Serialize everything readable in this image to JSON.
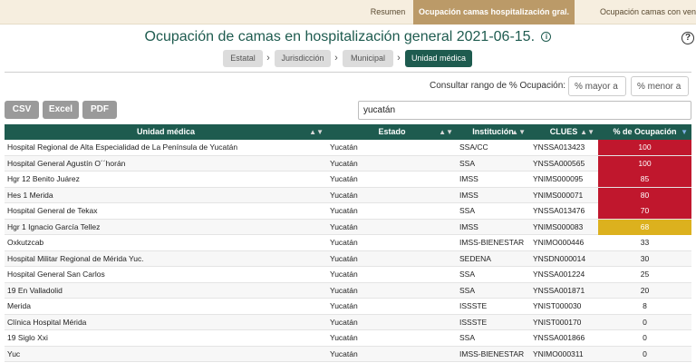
{
  "tabs": [
    {
      "label": "Resumen"
    },
    {
      "label": "Ocupación camas hospitalización gral."
    },
    {
      "label": "Ocupación camas con venti"
    }
  ],
  "title": "Ocupación de camas en hospitalización general 2021-06-15.",
  "info_glyph": "i",
  "help_glyph": "?",
  "breadcrumb": [
    {
      "label": "Estatal"
    },
    {
      "label": "Jurisdicción"
    },
    {
      "label": "Municipal"
    },
    {
      "label": "Unidad médica"
    }
  ],
  "range": {
    "label": "Consultar rango de % Ocupación:",
    "mayor_placeholder": "% mayor a",
    "menor_placeholder": "% menor a"
  },
  "export": {
    "csv": "CSV",
    "excel": "Excel",
    "pdf": "PDF"
  },
  "search": {
    "value": "yucatán"
  },
  "colors": {
    "primary": "#1e5b4f",
    "tab_active": "#bb9a68",
    "high": "#c0172d",
    "medium": "#dcb11e"
  },
  "table": {
    "columns": [
      {
        "label": "Unidad médica"
      },
      {
        "label": "Estado"
      },
      {
        "label": "Institución"
      },
      {
        "label": "CLUES"
      },
      {
        "label": "% de Ocupación"
      }
    ],
    "rows": [
      {
        "unidad": "Hospital Regional de Alta Especialidad de La Península de Yucatán",
        "estado": "Yucatán",
        "institucion": "SSA/CC",
        "clues": "YNSSA013423",
        "ocupacion": "100",
        "level": "high"
      },
      {
        "unidad": "Hospital General Agustín O´´horán",
        "estado": "Yucatán",
        "institucion": "SSA",
        "clues": "YNSSA000565",
        "ocupacion": "100",
        "level": "high"
      },
      {
        "unidad": "Hgr 12 Benito Juárez",
        "estado": "Yucatán",
        "institucion": "IMSS",
        "clues": "YNIMS000095",
        "ocupacion": "85",
        "level": "high"
      },
      {
        "unidad": "Hes 1 Merida",
        "estado": "Yucatán",
        "institucion": "IMSS",
        "clues": "YNIMS000071",
        "ocupacion": "80",
        "level": "high"
      },
      {
        "unidad": "Hospital General de Tekax",
        "estado": "Yucatán",
        "institucion": "SSA",
        "clues": "YNSSA013476",
        "ocupacion": "70",
        "level": "high"
      },
      {
        "unidad": "Hgr 1 Ignacio García Tellez",
        "estado": "Yucatán",
        "institucion": "IMSS",
        "clues": "YNIMS000083",
        "ocupacion": "68",
        "level": "medium"
      },
      {
        "unidad": "Oxkutzcab",
        "estado": "Yucatán",
        "institucion": "IMSS-BIENESTAR",
        "clues": "YNIMO000446",
        "ocupacion": "33",
        "level": "low"
      },
      {
        "unidad": "Hospital Militar Regional de Mérida Yuc.",
        "estado": "Yucatán",
        "institucion": "SEDENA",
        "clues": "YNSDN000014",
        "ocupacion": "30",
        "level": "low"
      },
      {
        "unidad": "Hospital General San Carlos",
        "estado": "Yucatán",
        "institucion": "SSA",
        "clues": "YNSSA001224",
        "ocupacion": "25",
        "level": "low"
      },
      {
        "unidad": "19 En Valladolid",
        "estado": "Yucatán",
        "institucion": "SSA",
        "clues": "YNSSA001871",
        "ocupacion": "20",
        "level": "low"
      },
      {
        "unidad": "Merida",
        "estado": "Yucatán",
        "institucion": "ISSSTE",
        "clues": "YNIST000030",
        "ocupacion": "8",
        "level": "low"
      },
      {
        "unidad": "Clínica Hospital Mérida",
        "estado": "Yucatán",
        "institucion": "ISSSTE",
        "clues": "YNIST000170",
        "ocupacion": "0",
        "level": "low"
      },
      {
        "unidad": "19 Siglo Xxi",
        "estado": "Yucatán",
        "institucion": "SSA",
        "clues": "YNSSA001866",
        "ocupacion": "0",
        "level": "low"
      },
      {
        "unidad": "Yuc",
        "estado": "Yucatán",
        "institucion": "IMSS-BIENESTAR",
        "clues": "YNIMO000311",
        "ocupacion": "0",
        "level": "low"
      }
    ]
  }
}
